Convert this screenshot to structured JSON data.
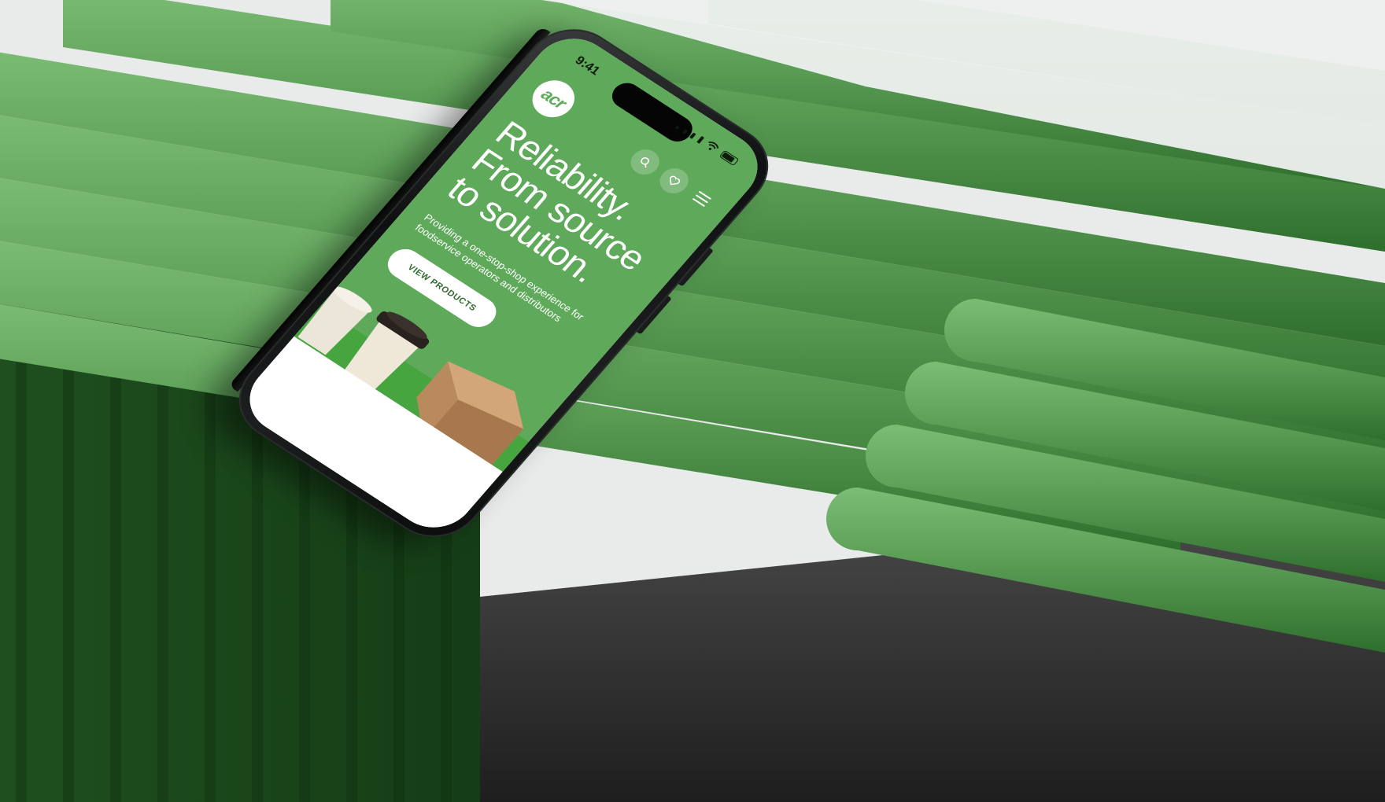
{
  "status_bar": {
    "time": "9:41"
  },
  "site": {
    "logo_text": "acr",
    "headline_lines": [
      "Reliability.",
      "From source",
      "to solution."
    ],
    "subheadline": "Providing a one-stop-shop experience for foodservice operators and distributors",
    "cta_label": "VIEW PRODUCTS",
    "nav_icons": [
      "search-icon",
      "heart-icon",
      "menu-icon"
    ]
  },
  "colors": {
    "brand_green": "#5ea95a",
    "cta_text": "#2f6b2c",
    "background_green": "#5f9a5a",
    "phone_frame": "#111213"
  }
}
